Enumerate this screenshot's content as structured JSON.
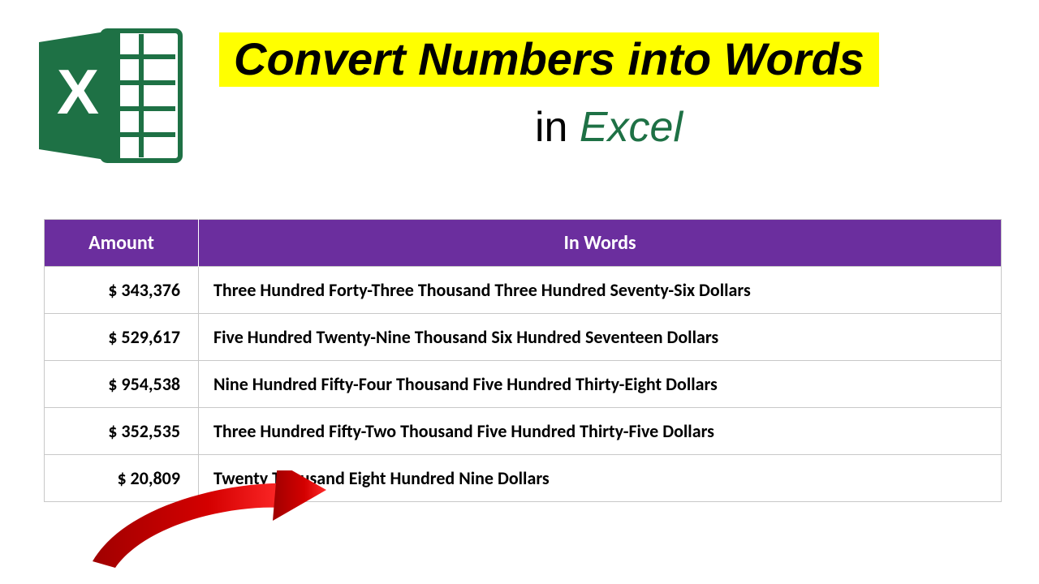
{
  "icon": {
    "name": "excel-icon",
    "letter": "X"
  },
  "title": {
    "highlight_text": "Convert Numbers into Words",
    "sub_in": "in ",
    "sub_app": "Excel",
    "highlight_bg": "#ffff00",
    "app_color": "#1e7145"
  },
  "table": {
    "header_bg": "#6b2e9e",
    "headers": {
      "amount": "Amount",
      "in_words": "In Words"
    },
    "rows": [
      {
        "amount": "$ 343,376",
        "words": "Three Hundred Forty-Three Thousand Three Hundred Seventy-Six Dollars"
      },
      {
        "amount": "$ 529,617",
        "words": "Five Hundred Twenty-Nine Thousand Six Hundred Seventeen Dollars"
      },
      {
        "amount": "$ 954,538",
        "words": "Nine Hundred Fifty-Four Thousand Five Hundred Thirty-Eight Dollars"
      },
      {
        "amount": "$ 352,535",
        "words": "Three Hundred Fifty-Two Thousand Five Hundred Thirty-Five Dollars"
      },
      {
        "amount": "$ 20,809",
        "words": "Twenty Thousand Eight Hundred Nine Dollars"
      }
    ]
  },
  "arrow": {
    "color": "#c00000"
  }
}
